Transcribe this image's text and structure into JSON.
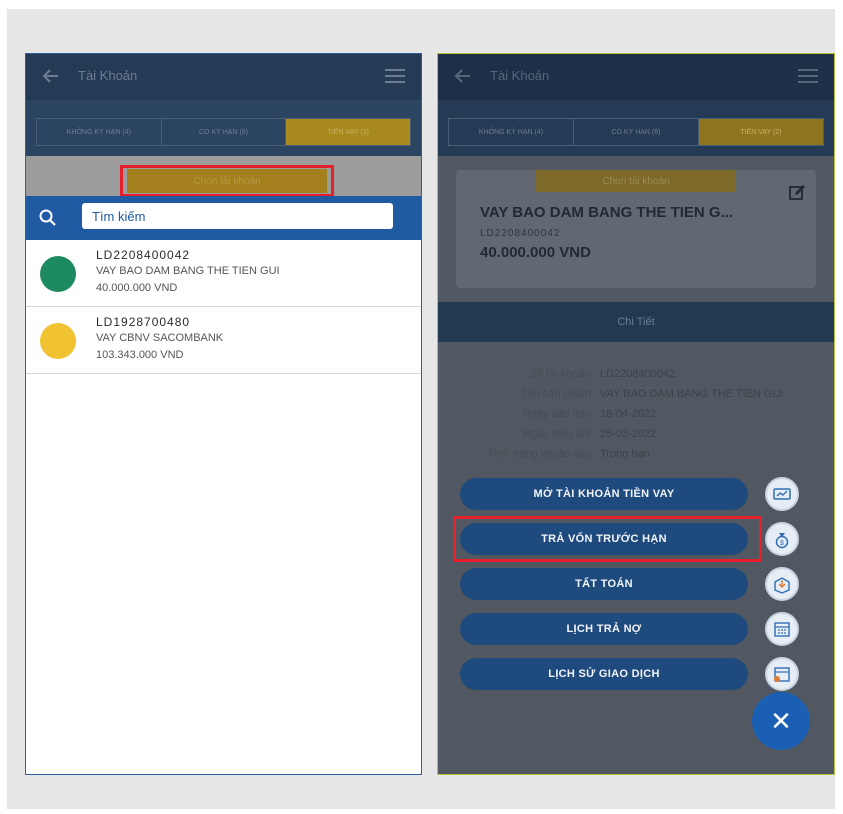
{
  "left_screen": {
    "header": {
      "title": "Tài Khoản"
    },
    "tabs": [
      {
        "label": "KHÔNG KỲ HẠN (4)"
      },
      {
        "label": "CÓ KỲ HẠN (6)"
      },
      {
        "label": "TIỀN VAY (2)"
      }
    ],
    "choose_account_label": "Chọn tài khoản",
    "search": {
      "placeholder": "Tìm kiếm",
      "value": ""
    },
    "accounts": [
      {
        "code": "LD2208400042",
        "name": "VAY BAO DAM BANG THE TIEN GUI",
        "amount": "40.000.000 VND",
        "color": "#1e8a5f"
      },
      {
        "code": "LD1928700480",
        "name": "VAY CBNV SACOMBANK",
        "amount": "103.343.000 VND",
        "color": "#f1c232"
      }
    ]
  },
  "right_screen": {
    "header": {
      "title": "Tài Khoản"
    },
    "tabs": [
      {
        "label": "KHÔNG KỲ HẠN (4)"
      },
      {
        "label": "CÓ KỲ HẠN (6)"
      },
      {
        "label": "TIỀN VAY (2)"
      }
    ],
    "card": {
      "choose_label": "Chọn tài khoản",
      "name": "VAY BAO DAM BANG THE TIEN G...",
      "code": "LD2208400042",
      "amount": "40.000.000 VND"
    },
    "detail_title": "Chi Tiết",
    "details": [
      {
        "key": "Số tài khoản:",
        "value": "LD2208400042"
      },
      {
        "key": "Tên sản phẩm:",
        "value": "VAY BAO DAM BANG THE TIEN GUI"
      },
      {
        "key": "Ngày đáo hạn:",
        "value": "18-04-2022"
      },
      {
        "key": "Ngày hiệu lực:",
        "value": "25-03-2022"
      },
      {
        "key": "Tình trạng khoản vay:",
        "value": "Trong hạn"
      }
    ],
    "actions": [
      {
        "label": "MỞ TÀI KHOẢN TIỀN VAY",
        "icon": "open-loan-icon"
      },
      {
        "label": "TRẢ VỐN TRƯỚC HẠN",
        "icon": "money-bag-icon"
      },
      {
        "label": "TẤT TOÁN",
        "icon": "settle-box-icon"
      },
      {
        "label": "LỊCH TRẢ NỢ",
        "icon": "calendar-icon"
      },
      {
        "label": "LỊCH SỬ GIAO DỊCH",
        "icon": "history-calendar-icon"
      }
    ]
  },
  "colors": {
    "highlight": "#e5202c",
    "accent": "#1a5fb4",
    "tab_active": "#a7891e"
  }
}
